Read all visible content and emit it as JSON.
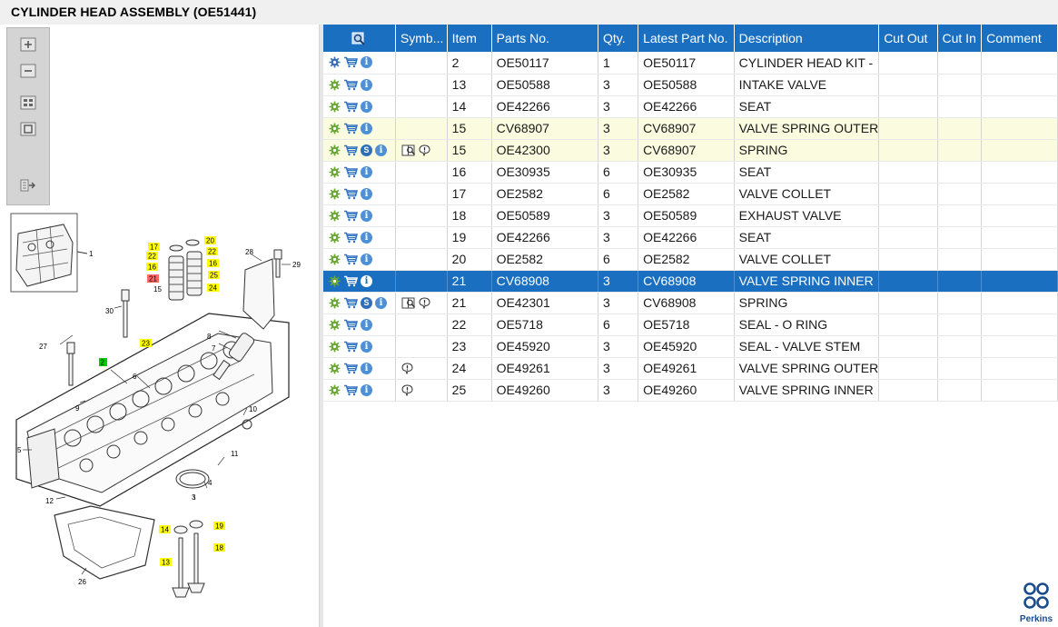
{
  "title": "CYLINDER HEAD ASSEMBLY (OE51441)",
  "columns": [
    "",
    "Symb...",
    "Item",
    "Parts No.",
    "Qty.",
    "Latest Part No.",
    "Description",
    "Cut Out",
    "Cut In",
    "Comment"
  ],
  "rows": [
    {
      "item": "2",
      "part": "OE50117",
      "qty": "1",
      "latest": "OE50117",
      "desc": "CYLINDER HEAD KIT -"
    },
    {
      "item": "13",
      "part": "OE50588",
      "qty": "3",
      "latest": "OE50588",
      "desc": "INTAKE VALVE"
    },
    {
      "item": "14",
      "part": "OE42266",
      "qty": "3",
      "latest": "OE42266",
      "desc": "SEAT"
    },
    {
      "item": "15",
      "part": "CV68907",
      "qty": "3",
      "latest": "CV68907",
      "desc": "VALVE SPRING OUTER"
    },
    {
      "item": "15",
      "part": "OE42300",
      "qty": "3",
      "latest": "CV68907",
      "desc": "SPRING"
    },
    {
      "item": "16",
      "part": "OE30935",
      "qty": "6",
      "latest": "OE30935",
      "desc": "SEAT"
    },
    {
      "item": "17",
      "part": "OE2582",
      "qty": "6",
      "latest": "OE2582",
      "desc": "VALVE COLLET"
    },
    {
      "item": "18",
      "part": "OE50589",
      "qty": "3",
      "latest": "OE50589",
      "desc": "EXHAUST VALVE"
    },
    {
      "item": "19",
      "part": "OE42266",
      "qty": "3",
      "latest": "OE42266",
      "desc": "SEAT"
    },
    {
      "item": "20",
      "part": "OE2582",
      "qty": "6",
      "latest": "OE2582",
      "desc": "VALVE COLLET"
    },
    {
      "item": "21",
      "part": "CV68908",
      "qty": "3",
      "latest": "CV68908",
      "desc": "VALVE SPRING INNER"
    },
    {
      "item": "21",
      "part": "OE42301",
      "qty": "3",
      "latest": "CV68908",
      "desc": "SPRING"
    },
    {
      "item": "22",
      "part": "OE5718",
      "qty": "6",
      "latest": "OE5718",
      "desc": "SEAL - O RING"
    },
    {
      "item": "23",
      "part": "OE45920",
      "qty": "3",
      "latest": "OE45920",
      "desc": "SEAL - VALVE STEM"
    },
    {
      "item": "24",
      "part": "OE49261",
      "qty": "3",
      "latest": "OE49261",
      "desc": "VALVE SPRING OUTER"
    },
    {
      "item": "25",
      "part": "OE49260",
      "qty": "3",
      "latest": "OE49260",
      "desc": "VALVE SPRING INNER"
    }
  ],
  "row_icons": [
    [
      "gears-icon",
      "cart-icon",
      "info-icon"
    ],
    [
      "gear-icon",
      "cart-icon",
      "info-icon"
    ],
    [
      "gear-icon",
      "cart-icon",
      "info-icon"
    ],
    [
      "gear-icon",
      "cart-icon",
      "info-icon"
    ],
    [
      "gear-icon",
      "cart-icon",
      "supersession-icon",
      "info-icon"
    ],
    [
      "gear-icon",
      "cart-icon",
      "info-icon"
    ],
    [
      "gear-icon",
      "cart-icon",
      "info-icon"
    ],
    [
      "gear-icon",
      "cart-icon",
      "info-icon"
    ],
    [
      "gear-icon",
      "cart-icon",
      "info-icon"
    ],
    [
      "gear-icon",
      "cart-icon",
      "info-icon"
    ],
    [
      "gear-icon",
      "cart-icon",
      "info-icon"
    ],
    [
      "gear-icon",
      "cart-icon",
      "supersession-icon",
      "info-icon"
    ],
    [
      "gear-icon",
      "cart-icon",
      "info-icon"
    ],
    [
      "gear-icon",
      "cart-icon",
      "info-icon"
    ],
    [
      "gear-icon",
      "cart-icon",
      "info-icon"
    ],
    [
      "gear-icon",
      "cart-icon",
      "info-icon"
    ]
  ],
  "row_symbols": [
    [],
    [],
    [],
    [],
    [
      "book-icon",
      "note-icon"
    ],
    [],
    [],
    [],
    [],
    [],
    [],
    [
      "book-icon",
      "note-icon"
    ],
    [],
    [],
    [
      "note-icon"
    ],
    [
      "note-icon"
    ]
  ],
  "row_state": [
    "normal",
    "normal",
    "normal",
    "highlight",
    "highlight",
    "normal",
    "normal",
    "normal",
    "normal",
    "normal",
    "selected",
    "normal",
    "normal",
    "normal",
    "normal",
    "normal"
  ],
  "supersession_label": "S",
  "info_label": "i",
  "zoom_toolbar": [
    "zoom-in-icon",
    "zoom-out-icon",
    "fit-all-icon",
    "fit-window-icon",
    "export-icon"
  ],
  "diagram_callouts": [
    "1",
    "2",
    "3",
    "4",
    "5",
    "6",
    "7",
    "8",
    "9",
    "10",
    "11",
    "12",
    "13",
    "14",
    "15",
    "16",
    "17",
    "18",
    "19",
    "20",
    "21",
    "22",
    "23",
    "24",
    "25",
    "26",
    "27",
    "28",
    "29",
    "30"
  ],
  "logo_text": "Perkins",
  "colors": {
    "header_blue": "#1a6fc0",
    "selected_row": "#1a6fc0",
    "highlight_row": "#fbfbdf",
    "callout_yellow": "#ffff00",
    "callout_green": "#00cc00",
    "callout_red": "#ff6666",
    "logo_blue": "#1a4c8c"
  }
}
